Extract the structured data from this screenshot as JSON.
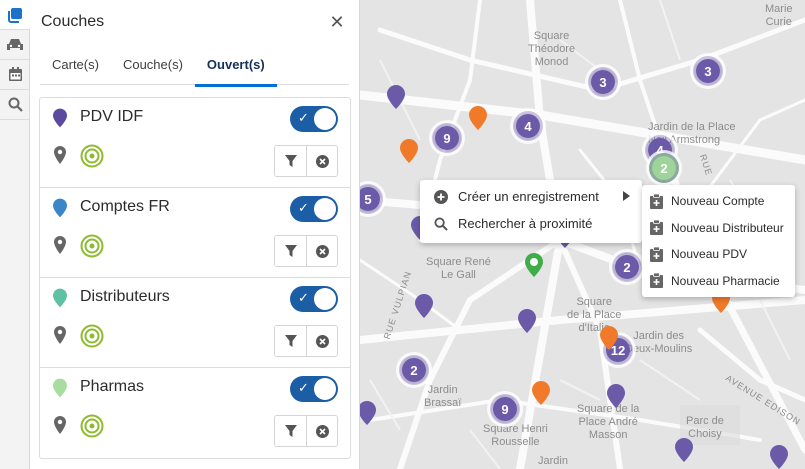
{
  "panel": {
    "title": "Couches",
    "close_symbol": "✕",
    "tabs": [
      {
        "label": "Carte(s)",
        "active": false
      },
      {
        "label": "Couche(s)",
        "active": false
      },
      {
        "label": "Ouvert(s)",
        "active": true
      }
    ],
    "layers": [
      {
        "name": "PDV IDF",
        "pin_color": "#5b4a9e",
        "enabled": true
      },
      {
        "name": "Comptes FR",
        "pin_color": "#3a86c8",
        "enabled": true
      },
      {
        "name": "Distributeurs",
        "pin_color": "#5fc1a4",
        "enabled": true
      },
      {
        "name": "Pharmas",
        "pin_color": "#a8dca0",
        "enabled": true
      }
    ]
  },
  "rail": {
    "icons": [
      "layers-icon",
      "car-icon",
      "calendar-icon",
      "search-icon"
    ]
  },
  "context_menu": {
    "items": [
      {
        "label": "Créer un enregistrement",
        "icon": "plus-circle-icon",
        "has_submenu": true
      },
      {
        "label": "Rechercher à proximité",
        "icon": "search-icon"
      }
    ],
    "submenu": [
      {
        "label": "Nouveau Compte",
        "icon": "clipboard-add-icon"
      },
      {
        "label": "Nouveau Distributeur",
        "icon": "clipboard-add-icon"
      },
      {
        "label": "Nouveau PDV",
        "icon": "clipboard-add-icon"
      },
      {
        "label": "Nouveau Pharmacie",
        "icon": "clipboard-add-icon"
      }
    ]
  },
  "map": {
    "labels": {
      "marie_curie": "Marie\nCurie",
      "square_theodore": "Square\nThéodore\nMonod",
      "jardin_place": "Jardin de la Place\nNeil Armstrong",
      "square_rene": "Square René\nLe Gall",
      "square_place_italie": "Square\nde la Place\nd'Italie",
      "jardin_moulins": "Jardin des\nDeux-Moulins",
      "jardin_brassai": "Jardin\nBrassaï",
      "square_henri": "Square Henri\nRousselle",
      "square_andre": "Square de la\nPlace André\nMasson",
      "parc_choisy": "Parc de\nChoisy",
      "jardin_bottom": "Jardin"
    },
    "streets": {
      "rue_vulpian": "RUE VULPIAN",
      "avenue_edison": "AVENUE EDISON",
      "rue_bobillot": "RUE DE",
      "rue_right": "RUE"
    },
    "clusters": [
      {
        "count": "3"
      },
      {
        "count": "3"
      },
      {
        "count": "9"
      },
      {
        "count": "4"
      },
      {
        "count": "4"
      },
      {
        "count": "2"
      },
      {
        "count": "5"
      },
      {
        "count": "2"
      },
      {
        "count": "12"
      },
      {
        "count": "2"
      },
      {
        "count": "9"
      }
    ],
    "colors": {
      "purple": "#6b5aa8",
      "orange": "#f07a2a",
      "green": "#3fae49"
    }
  }
}
